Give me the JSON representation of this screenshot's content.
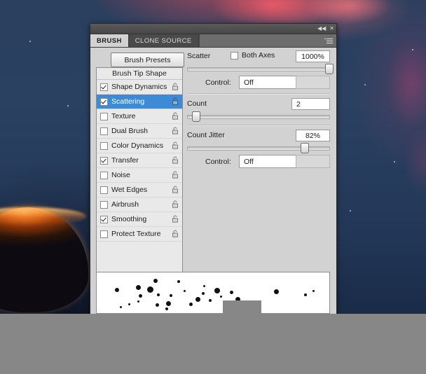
{
  "window": {
    "titlebar_icons": [
      "collapse-icon",
      "close-icon"
    ],
    "collapse_glyph": "◀◀",
    "close_glyph": "✕"
  },
  "tabs": [
    {
      "label": "BRUSH",
      "active": true
    },
    {
      "label": "CLONE SOURCE",
      "active": false
    }
  ],
  "toolbar": {
    "brush_presets_label": "Brush Presets"
  },
  "brush_list": {
    "header": "Brush Tip Shape",
    "items": [
      {
        "label": "Shape Dynamics",
        "checked": true,
        "selected": false,
        "locked": true
      },
      {
        "label": "Scattering",
        "checked": true,
        "selected": true,
        "locked": true
      },
      {
        "label": "Texture",
        "checked": false,
        "selected": false,
        "locked": true
      },
      {
        "label": "Dual Brush",
        "checked": false,
        "selected": false,
        "locked": true
      },
      {
        "label": "Color Dynamics",
        "checked": false,
        "selected": false,
        "locked": true
      },
      {
        "label": "Transfer",
        "checked": true,
        "selected": false,
        "locked": true
      },
      {
        "label": "Noise",
        "checked": false,
        "selected": false,
        "locked": true
      },
      {
        "label": "Wet Edges",
        "checked": false,
        "selected": false,
        "locked": true
      },
      {
        "label": "Airbrush",
        "checked": false,
        "selected": false,
        "locked": true
      },
      {
        "label": "Smoothing",
        "checked": true,
        "selected": false,
        "locked": true
      },
      {
        "label": "Protect Texture",
        "checked": false,
        "selected": false,
        "locked": true
      }
    ]
  },
  "scattering": {
    "scatter": {
      "label": "Scatter",
      "value": "1000%",
      "slider_percent": 100,
      "both_axes_label": "Both Axes",
      "both_axes_checked": false,
      "control_label": "Control:",
      "control_value": "Off"
    },
    "count": {
      "label": "Count",
      "value": "2",
      "slider_percent": 6
    },
    "count_jitter": {
      "label": "Count Jitter",
      "value": "82%",
      "slider_percent": 82,
      "control_label": "Control:",
      "control_value": "Off"
    }
  },
  "preview": {
    "name": "brush-stroke-preview"
  },
  "colors": {
    "panel_bg": "#d2d2d2",
    "selection_blue": "#3d8ad6",
    "tab_active_bg": "#d2d2d2",
    "titlebar": "#4f4f4f",
    "backdrop_blue": "#2a4161",
    "nebula_red": "#ff505a",
    "planet_rim": "#e8701c",
    "occluder_gray": "#878787"
  }
}
